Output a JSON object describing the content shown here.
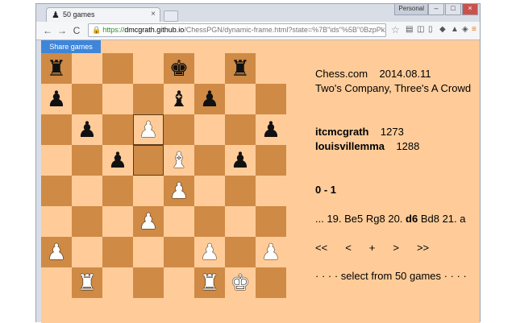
{
  "tab": {
    "title": "50 games",
    "close": "×"
  },
  "profile": "Personal",
  "window_buttons": [
    "–",
    "□",
    "×"
  ],
  "toolbar": {
    "back": "←",
    "forward": "→",
    "reload": "C",
    "url_scheme": "https://",
    "url_host": "dmcgrath.github.io",
    "url_rest": "/ChessPGN/dynamic-frame.html?state=%7B\"ids\"%5B\"0BzpPkkRLKKCt",
    "star": "☆",
    "extensions": [
      "▤",
      "◫",
      "▯",
      "◆",
      "▲",
      "◈",
      "≡"
    ]
  },
  "share_button": "Share games",
  "board": [
    [
      "r",
      "",
      "",
      "",
      "k",
      "",
      "r",
      ""
    ],
    [
      "p",
      "",
      "",
      "",
      "b",
      "p",
      "",
      ""
    ],
    [
      "",
      "p",
      "",
      "P",
      "",
      "",
      "",
      "p"
    ],
    [
      "",
      "",
      "p",
      "",
      "B",
      "",
      "p",
      ""
    ],
    [
      "",
      "",
      "",
      "",
      "P",
      "",
      "",
      ""
    ],
    [
      "",
      "",
      "",
      "P",
      "",
      "",
      "",
      ""
    ],
    [
      "P",
      "",
      "",
      "",
      "",
      "P",
      "",
      "P"
    ],
    [
      "",
      "R",
      "",
      "",
      "",
      "R",
      "K",
      ""
    ]
  ],
  "highlight": [
    [
      2,
      3
    ],
    [
      3,
      3
    ]
  ],
  "game": {
    "site": "Chess.com",
    "date": "2014.08.11",
    "event": "Two's Company, Three's A Crowd",
    "white": "itcmcgrath",
    "white_elo": "1273",
    "black": "louisvillemma",
    "black_elo": "1288",
    "result": "0 - 1",
    "moves_before": "... 19. Be5 Rg8 20.",
    "current_move": "d6",
    "moves_after": "Bd8 21. a"
  },
  "nav": {
    "first": "<<",
    "prev": "<",
    "plus": "+",
    "next": ">",
    "last": ">>"
  },
  "select_games": "· · · · select from 50 games · · · ·"
}
